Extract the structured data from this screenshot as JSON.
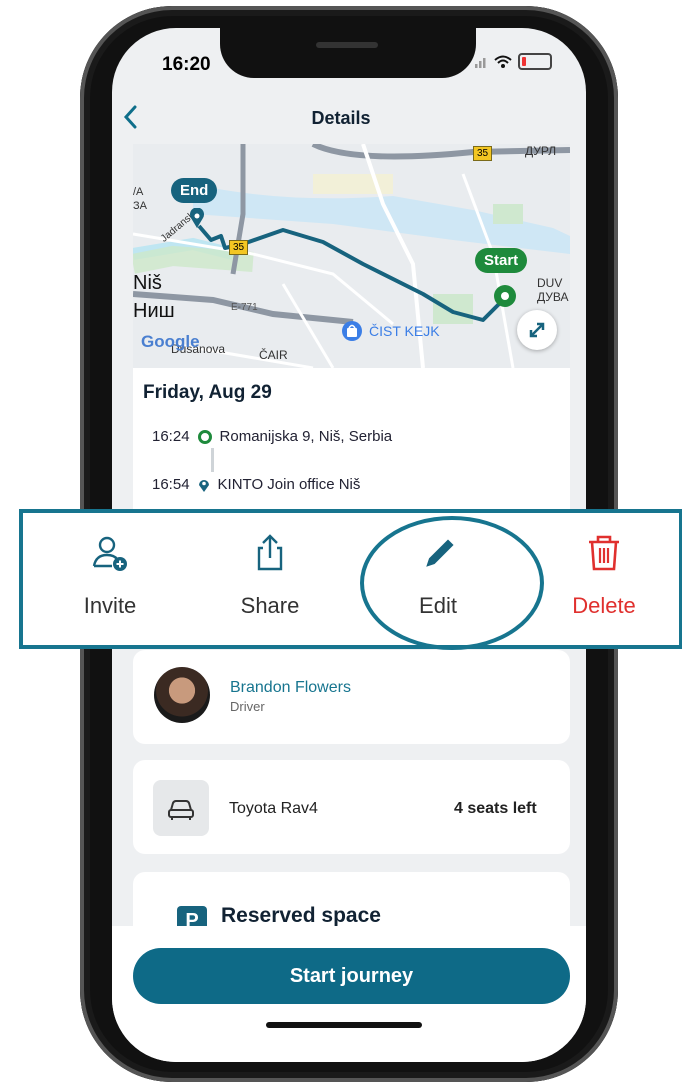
{
  "status": {
    "time": "16:20"
  },
  "header": {
    "title": "Details",
    "back_icon": "chevron-left-icon"
  },
  "map": {
    "places": [
      "Niš",
      "Ниш",
      "ДУРЛ",
      "DUV",
      "ДУВА",
      "ČAIR",
      "Dusanova",
      "/A",
      "ЗА",
      "Jadranska"
    ],
    "roads": [
      "35",
      "35",
      "E-771"
    ],
    "poi": "ČIST KEJK",
    "start_label": "Start",
    "end_label": "End",
    "attribution": "Google",
    "expand_icon": "expand-icon"
  },
  "trip": {
    "date": "Friday, Aug 29",
    "start": {
      "time": "16:24",
      "address": "Romanijska 9, Niš, Serbia"
    },
    "end": {
      "time": "16:54",
      "address": "KINTO Join office Niš"
    }
  },
  "actions": {
    "invite": "Invite",
    "share": "Share",
    "edit": "Edit",
    "delete": "Delete"
  },
  "driver": {
    "name": "Brandon Flowers",
    "role": "Driver"
  },
  "vehicle": {
    "model": "Toyota Rav4",
    "seats": "4 seats left"
  },
  "parking": {
    "badge": "P",
    "title": "Reserved space"
  },
  "cta": {
    "label": "Start journey"
  },
  "colors": {
    "primary": "#0e6a87",
    "start_green": "#1e8a3c",
    "delete_red": "#e0302e"
  }
}
